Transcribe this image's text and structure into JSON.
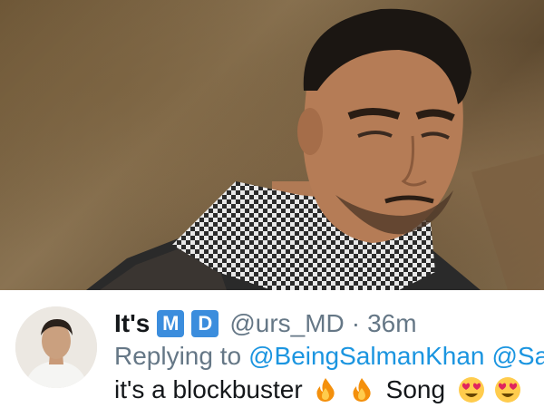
{
  "tweet": {
    "display_name": "It's",
    "badges": [
      "M",
      "D"
    ],
    "handle": "@urs_MD",
    "separator": "·",
    "time": "36m",
    "reply_prefix": "Replying to",
    "mentions": [
      "@BeingSalmanKhan",
      "@Sa"
    ],
    "text_part1": "it's a blockbuster",
    "text_part2": "Song",
    "emojis": [
      "fire-emoji",
      "fire-emoji",
      "heart-eyes-emoji",
      "heart-eyes-emoji"
    ]
  },
  "colors": {
    "badge_blue": "#3b8ddd",
    "mention_blue": "#1b95e0",
    "muted_gray": "#657786",
    "text_dark": "#14171a"
  }
}
